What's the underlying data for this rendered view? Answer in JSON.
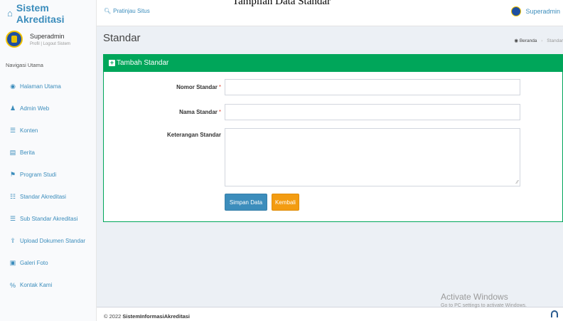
{
  "caption": "Tampilan Data Standar",
  "brand": {
    "title": "Sistem Akreditasi",
    "icon": "home-icon"
  },
  "user_panel": {
    "name": "Superadmin",
    "profile_link": "Profil",
    "separator": "|",
    "logout_link": "Logout Sistem"
  },
  "sidebar": {
    "header": "Navigasi Utama",
    "items": [
      {
        "label": "Halaman Utama",
        "icon": "dashboard-icon",
        "glyph": "◉"
      },
      {
        "label": "Admin Web",
        "icon": "user-icon",
        "glyph": "♟"
      },
      {
        "label": "Konten",
        "icon": "list-icon",
        "glyph": "☰"
      },
      {
        "label": "Berita",
        "icon": "newspaper-icon",
        "glyph": "▤"
      },
      {
        "label": "Program Studi",
        "icon": "flag-icon",
        "glyph": "⚑"
      },
      {
        "label": "Standar Akreditasi",
        "icon": "list-ol-icon",
        "glyph": "☷"
      },
      {
        "label": "Sub Standar Akreditasi",
        "icon": "list-icon",
        "glyph": "☰"
      },
      {
        "label": "Upload Dokumen Standar",
        "icon": "upload-icon",
        "glyph": "⇪"
      },
      {
        "label": "Galeri Foto",
        "icon": "image-icon",
        "glyph": "▣"
      },
      {
        "label": "Kontak Kami",
        "icon": "link-icon",
        "glyph": "%"
      }
    ]
  },
  "topbar": {
    "preview_label": "Pratinjau Situs",
    "user": "Superadmin"
  },
  "content": {
    "title": "Standar",
    "breadcrumb": {
      "home": "Beranda",
      "current": "Standar"
    }
  },
  "form": {
    "box_title": "Tambah Standar",
    "nomor_label": "Nomor Standar",
    "nomor_value": "",
    "nama_label": "Nama Standar",
    "nama_value": "",
    "keterangan_label": "Keterangan Standar",
    "keterangan_value": "",
    "required_mark": "*",
    "save_label": "Simpan Data",
    "back_label": "Kembali"
  },
  "footer": {
    "year": "© 2022",
    "site": "SistemInformasiAkreditasi"
  },
  "watermark": {
    "title": "Activate Windows",
    "subtitle": "Go to PC settings to activate Windows."
  },
  "colors": {
    "primary": "#3c8dbc",
    "success": "#00a65a",
    "warning": "#f39c12",
    "danger": "#dd4b39"
  }
}
